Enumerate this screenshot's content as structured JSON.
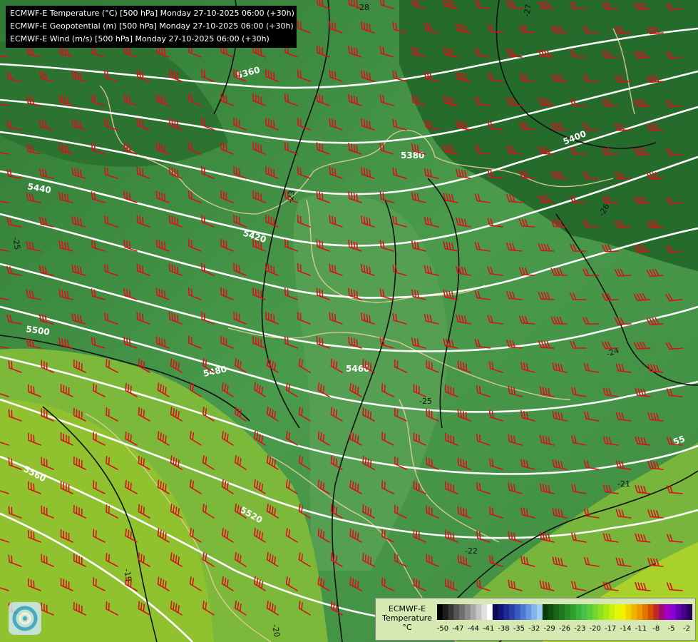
{
  "header": {
    "lines": [
      "ECMWF-E Temperature (°C) [500 hPa] Monday 27-10-2025 06:00 (+30h)",
      "ECMWF-E Geopotential (m) [500 hPa] Monday 27-10-2025 06:00 (+30h)",
      "ECMWF-E Wind (m/s) [500 hPa] Monday 27-10-2025 06:00 (+30h)"
    ]
  },
  "contours": {
    "geopotential_labels": [
      "5360",
      "5380",
      "5400",
      "5420",
      "5440",
      "5460",
      "5480",
      "5500",
      "5520",
      "5560",
      "55"
    ],
    "temperature_labels": [
      "-28",
      "-27",
      "-26",
      "-24",
      "-25",
      "-23",
      "-22",
      "-21",
      "-19",
      "-20",
      "-25"
    ]
  },
  "legend": {
    "title_line1": "ECMWF-E",
    "title_line2": "Temperature",
    "unit": "°C",
    "colors": [
      "#000000",
      "#1c1c1c",
      "#383838",
      "#555555",
      "#707070",
      "#8c8c8c",
      "#a8a8a8",
      "#c4c4c4",
      "#e0e0e0",
      "#ffffff",
      "#0a0a50",
      "#141478",
      "#1e2896",
      "#2a40aa",
      "#3a5ac0",
      "#4f78d2",
      "#6896e0",
      "#84b4ee",
      "#a2d0f8",
      "#0a3c0a",
      "#115011",
      "#186418",
      "#1f781f",
      "#278c27",
      "#30a030",
      "#3cb43c",
      "#49c049",
      "#5acc3c",
      "#72d62f",
      "#8ee022",
      "#aaea14",
      "#c6f20a",
      "#e2fa05",
      "#f0f000",
      "#f0d200",
      "#f0b400",
      "#f09600",
      "#e07800",
      "#d25000",
      "#c02828",
      "#a00a78",
      "#a000c8",
      "#8c00d2",
      "#6400b4",
      "#46008c",
      "#2a005a"
    ],
    "ticks": [
      "-50",
      "-47",
      "-44",
      "-41",
      "-38",
      "-35",
      "-32",
      "-29",
      "-26",
      "-23",
      "-20",
      "-17",
      "-14",
      "-11",
      "-8",
      "-5",
      "-2"
    ]
  }
}
